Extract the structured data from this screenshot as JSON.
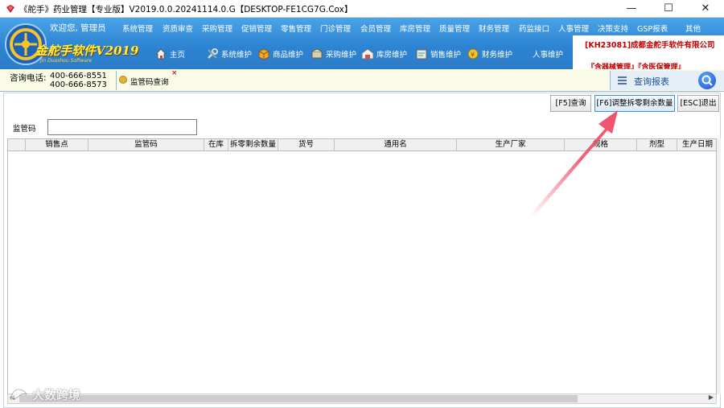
{
  "window": {
    "title": "《舵手》药业管理【专业版】V2019.0.0.20241114.0.G【DESKTOP-FE1CG7G.Cox】",
    "minimize": "—",
    "maximize": "☐",
    "close": "✕"
  },
  "header": {
    "welcome": "欢迎您, 管理员",
    "menu": [
      "系统管理",
      "资质审查",
      "采购管理",
      "促销管理",
      "零售管理",
      "门诊管理",
      "会员管理",
      "库房管理",
      "质量管理",
      "财务管理",
      "药监接口",
      "人事管理",
      "决策支持",
      "GSP报表",
      "其他"
    ],
    "logo_text": "金舵手软件V2019",
    "logo_sub": "Jin Duoshou Software",
    "toolbar": [
      "主页",
      "系统维护",
      "商品维护",
      "采购维护",
      "库房维护",
      "销售维护",
      "财务维护",
      "人事维护"
    ],
    "company": "[KH23081]成都金舵手软件有限公司",
    "management": "『含器械管理』『含医保管理』"
  },
  "infobar": {
    "phone_label": "咨询电话:",
    "phone1": "400-666-8551",
    "phone2": "400-666-8573",
    "tab_label": "监管码查询",
    "tab_close": "×",
    "report_label": "查询报表"
  },
  "buttons": {
    "query": "[F5]查询",
    "adjust": "[F6]调整拆零剩余数量",
    "exit": "[ESC]退出"
  },
  "form": {
    "code_label": "监管码",
    "code_value": ""
  },
  "table": {
    "columns": [
      "",
      "销售点",
      "监管码",
      "在库",
      "拆零剩余数量",
      "货号",
      "通用名",
      "生产厂家",
      "规格",
      "剂型",
      "生产日期"
    ]
  },
  "watermark": {
    "text": "大数跨境"
  },
  "colors": {
    "header_blue": "#2d84d2",
    "company_red": "#c00000",
    "arrow_red": "#f0506e"
  }
}
